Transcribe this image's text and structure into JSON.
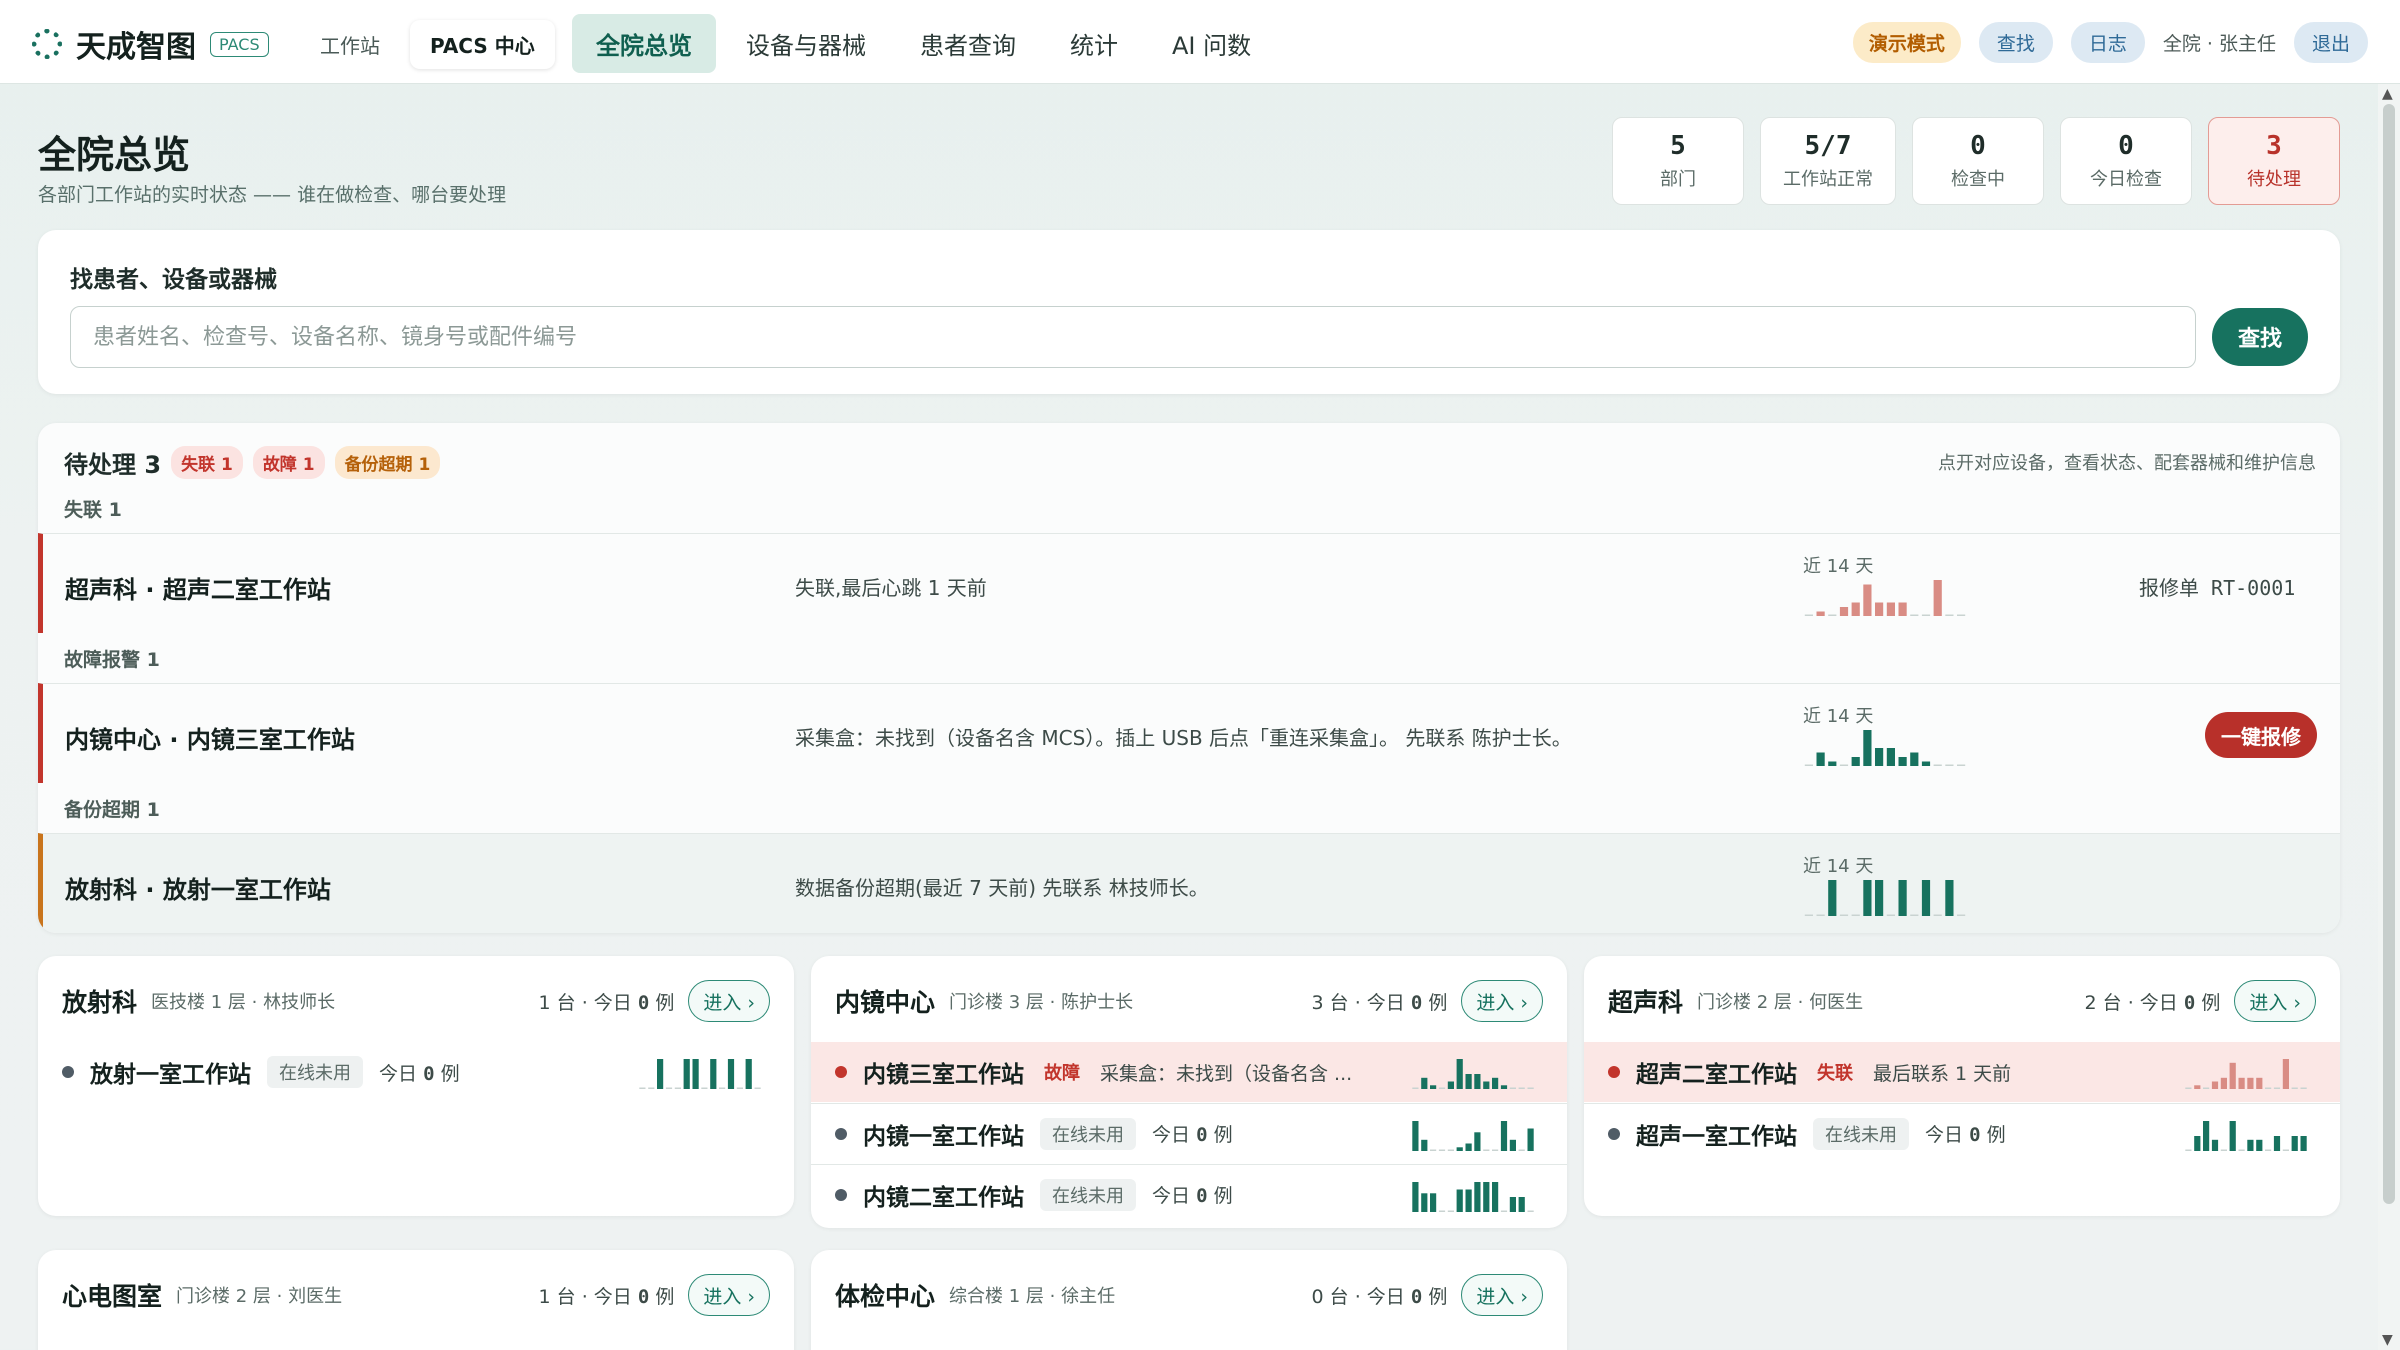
{
  "app": {
    "name": "天成智图",
    "tag": "PACS",
    "modes": [
      "工作站",
      "PACS 中心"
    ],
    "nav": [
      "全院总览",
      "设备与器械",
      "患者查询",
      "统计",
      "AI 问数"
    ],
    "demo_badge": "演示模式",
    "search_btn": "查找",
    "log_btn": "日志",
    "user": "全院 · 张主任",
    "logout_btn": "退出"
  },
  "page": {
    "title": "全院总览",
    "subtitle": "各部门工作站的实时状态 —— 谁在做检查、哪台要处理"
  },
  "stats": [
    {
      "value": "5",
      "label": "部门"
    },
    {
      "value": "5/7",
      "label": "工作站正常"
    },
    {
      "value": "0",
      "label": "检查中"
    },
    {
      "value": "0",
      "label": "今日检查"
    },
    {
      "value": "3",
      "label": "待处理"
    }
  ],
  "search": {
    "title": "找患者、设备或器械",
    "placeholder": "患者姓名、检查号、设备名称、镜身号或配件编号",
    "button": "查找"
  },
  "pending": {
    "title": "待处理 3",
    "chips": [
      "失联 1",
      "故障 1",
      "备份超期 1"
    ],
    "hint": "点开对应设备，查看状态、配套器械和维护信息",
    "groups": [
      {
        "label": "失联 1",
        "name": "超声科 · 超声二室工作站",
        "message": "失联,最后心跳 1 天前",
        "spark_label": "近 14 天",
        "spark": [
          0,
          1,
          0,
          2,
          3,
          7,
          3,
          3,
          3,
          0,
          0,
          8,
          0,
          0
        ],
        "color": "#d98c84",
        "action": "报修单 RT-0001"
      },
      {
        "label": "故障报警 1",
        "name": "内镜中心 · 内镜三室工作站",
        "message": "采集盒：未找到（设备名含 MCS）。插上 USB 后点「重连采集盒」。 先联系 陈护士长。",
        "spark_label": "近 14 天",
        "spark": [
          0,
          3,
          1,
          0,
          2,
          8,
          4,
          4,
          2,
          3,
          1,
          0,
          0,
          0
        ],
        "color": "#17725f",
        "action": "一键报修"
      },
      {
        "label": "备份超期 1",
        "name": "放射科 · 放射一室工作站",
        "message": "数据备份超期(最近 7 天前) 先联系 林技师长。",
        "spark_label": "近 14 天",
        "spark": [
          0,
          0,
          8,
          0,
          0,
          8,
          8,
          0,
          8,
          0,
          8,
          0,
          8,
          0
        ],
        "color": "#17725f",
        "action": ""
      }
    ]
  },
  "departments": [
    {
      "name": "放射科",
      "meta": "医技楼 1 层 · 林技师长",
      "count_prefix": "1 台 · 今日",
      "count": "0",
      "count_suffix": "例",
      "enter": "进入 ›",
      "stations": [
        {
          "name": "放射一室工作站",
          "status": "在线未用",
          "today_prefix": "今日",
          "today": "0",
          "today_suffix": "例",
          "alert": false,
          "spark": [
            0,
            0,
            8,
            0,
            0,
            8,
            8,
            0,
            8,
            0,
            8,
            0,
            8,
            0
          ],
          "color": "#17725f"
        }
      ]
    },
    {
      "name": "内镜中心",
      "meta": "门诊楼 3 层 · 陈护士长",
      "count_prefix": "3 台 · 今日",
      "count": "0",
      "count_suffix": "例",
      "enter": "进入 ›",
      "stations": [
        {
          "name": "内镜三室工作站",
          "status": "故障",
          "note": "采集盒：未找到（设备名含 ...",
          "alert": true,
          "spark": [
            0,
            3,
            1,
            0,
            2,
            8,
            4,
            4,
            2,
            3,
            1,
            0,
            0,
            0
          ],
          "color": "#17725f"
        },
        {
          "name": "内镜一室工作站",
          "status": "在线未用",
          "today_prefix": "今日",
          "today": "0",
          "today_suffix": "例",
          "alert": false,
          "spark": [
            8,
            3,
            0,
            0,
            0,
            1,
            2,
            5,
            0,
            0,
            8,
            3,
            0,
            6
          ],
          "color": "#17725f"
        },
        {
          "name": "内镜二室工作站",
          "status": "在线未用",
          "today_prefix": "今日",
          "today": "0",
          "today_suffix": "例",
          "alert": false,
          "spark": [
            8,
            5,
            5,
            0,
            0,
            6,
            6,
            8,
            8,
            8,
            0,
            4,
            4,
            0
          ],
          "color": "#17725f"
        }
      ]
    },
    {
      "name": "超声科",
      "meta": "门诊楼 2 层 · 何医生",
      "count_prefix": "2 台 · 今日",
      "count": "0",
      "count_suffix": "例",
      "enter": "进入 ›",
      "stations": [
        {
          "name": "超声二室工作站",
          "status": "失联",
          "note": "最后联系 1 天前",
          "alert": true,
          "spark": [
            0,
            1,
            0,
            2,
            3,
            7,
            3,
            3,
            3,
            0,
            0,
            8,
            0,
            0
          ],
          "color": "#d98c84"
        },
        {
          "name": "超声一室工作站",
          "status": "在线未用",
          "today_prefix": "今日",
          "today": "0",
          "today_suffix": "例",
          "alert": false,
          "spark": [
            0,
            4,
            8,
            3,
            0,
            8,
            0,
            3,
            3,
            0,
            4,
            0,
            4,
            4
          ],
          "color": "#17725f"
        }
      ]
    },
    {
      "name": "心电图室",
      "meta": "门诊楼 2 层 · 刘医生",
      "count_prefix": "1 台 · 今日",
      "count": "0",
      "count_suffix": "例",
      "enter": "进入 ›",
      "stations": []
    },
    {
      "name": "体检中心",
      "meta": "综合楼 1 层 · 徐主任",
      "count_prefix": "0 台 · 今日",
      "count": "0",
      "count_suffix": "例",
      "enter": "进入 ›",
      "stations": []
    }
  ]
}
